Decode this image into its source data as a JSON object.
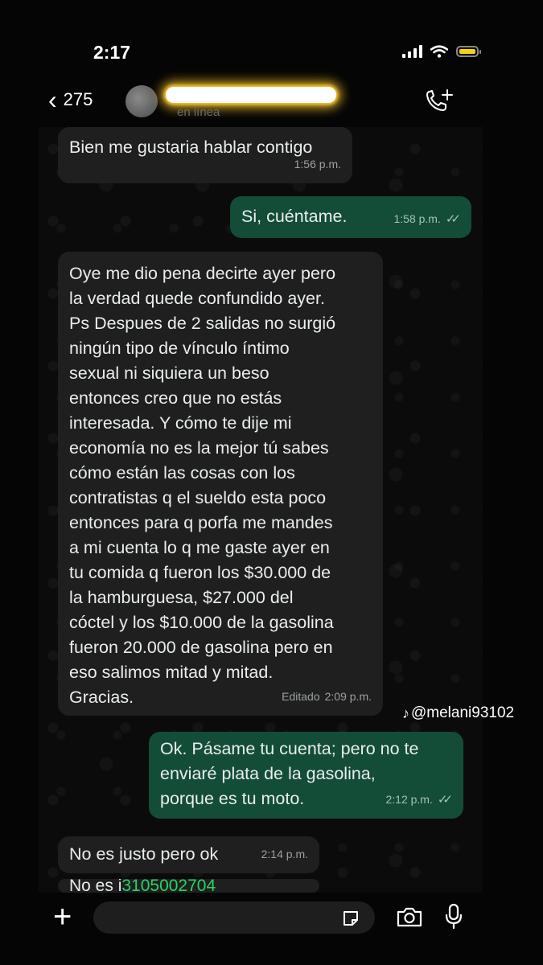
{
  "status": {
    "time": "2:17"
  },
  "header": {
    "back_count": "275",
    "contact_status": "en línea"
  },
  "messages": [
    {
      "direction": "incoming",
      "text": "Bien me gustaria hablar contigo",
      "time": "1:56 p.m."
    },
    {
      "direction": "outgoing",
      "text": "Si, cuéntame.",
      "time": "1:58 p.m.",
      "read": true
    },
    {
      "direction": "incoming",
      "lines": [
        "Oye me dio pena decirte ayer pero",
        "la verdad quede confundido ayer.",
        "Ps Despues de 2 salidas no surgió",
        "ningún tipo de vínculo íntimo",
        "sexual ni siquiera un beso",
        "entonces creo que no estás",
        "interesada. Y cómo te dije mi",
        "economía no es la mejor tú sabes",
        "cómo están las cosas con los",
        "contratistas q el sueldo esta poco",
        "entonces para q porfa me mandes",
        "a mi cuenta lo q me gaste ayer en",
        "tu comida q fueron los $30.000 de",
        "la hamburguesa, $27.000 del",
        "cóctel y los $10.000 de la gasolina",
        "fueron 20.000 de gasolina pero en",
        "eso salimos mitad y mitad.",
        "Gracias."
      ],
      "edited_label": "Editado",
      "time": "2:09 p.m."
    },
    {
      "direction": "outgoing",
      "lines": [
        "Ok. Pásame tu cuenta; pero no te",
        "enviaré plata de la gasolina,",
        "porque es tu moto."
      ],
      "time": "2:12 p.m.",
      "read": true
    },
    {
      "direction": "incoming",
      "text": "No es justo pero ok",
      "time": "2:14 p.m."
    },
    {
      "direction": "incoming",
      "partial_text": "No es i",
      "partial_number": "3105002704"
    }
  ],
  "watermark": {
    "text": "@melani93102"
  },
  "input": {
    "placeholder": ""
  },
  "colors": {
    "incoming_bubble": "#1f1f1f",
    "outgoing_bubble": "#134d37",
    "battery": "#f5d30f",
    "name_redaction_glow": "#ffd84a"
  }
}
